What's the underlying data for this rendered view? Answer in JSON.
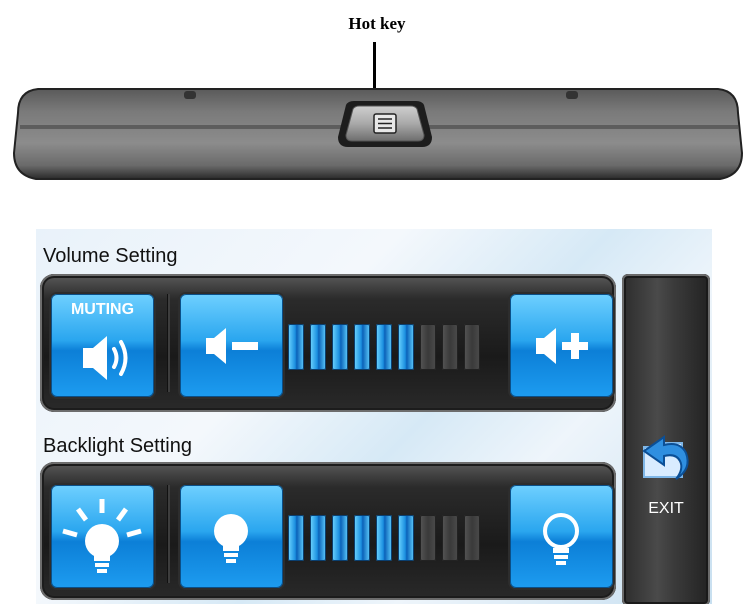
{
  "device": {
    "hotkey_label": "Hot key"
  },
  "volume": {
    "title": "Volume Setting",
    "mute_label": "MUTING",
    "level": 6,
    "max_level": 9
  },
  "backlight": {
    "title": "Backlight Setting",
    "level": 6,
    "max_level": 9
  },
  "exit": {
    "label": "EXIT"
  },
  "icons": [
    "menu-icon",
    "speaker-icon",
    "volume-down-icon",
    "volume-up-icon",
    "bright-bulb-icon",
    "bulb-icon",
    "bulb-outline-icon",
    "exit-arrow-icon"
  ],
  "colors": {
    "accent": "#1d9cf0",
    "bar_on": "#1b8fe0",
    "bar_off": "#3a3a3a"
  }
}
